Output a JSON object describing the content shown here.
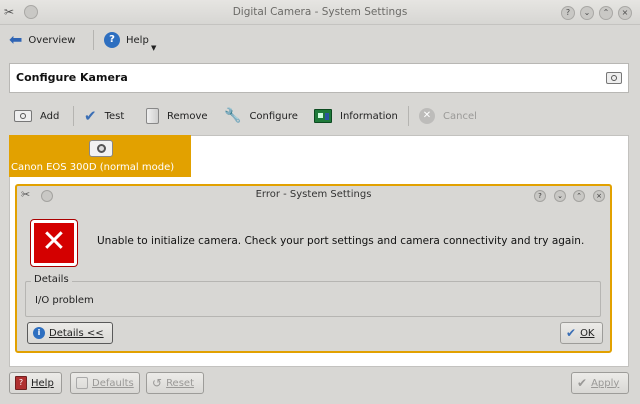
{
  "window": {
    "title": "Digital Camera - System Settings"
  },
  "toolbar": {
    "overview_label": "Overview",
    "help_label": "Help"
  },
  "header": {
    "title": "Configure Kamera"
  },
  "actions": {
    "add": "Add",
    "test": "Test",
    "remove": "Remove",
    "configure": "Configure",
    "information": "Information",
    "cancel": "Cancel"
  },
  "camera": {
    "label": "Canon EOS 300D (normal mode)"
  },
  "dialog": {
    "title": "Error - System Settings",
    "message": "Unable to initialize camera. Check your port settings and camera connectivity and try again.",
    "details_legend": "Details",
    "details_text": "I/O problem",
    "details_button": "Details <<",
    "ok_button": "OK"
  },
  "footer": {
    "help": "Help",
    "defaults": "Defaults",
    "reset": "Reset",
    "apply": "Apply"
  },
  "colors": {
    "accent": "#e2a100",
    "error": "#d40000"
  }
}
